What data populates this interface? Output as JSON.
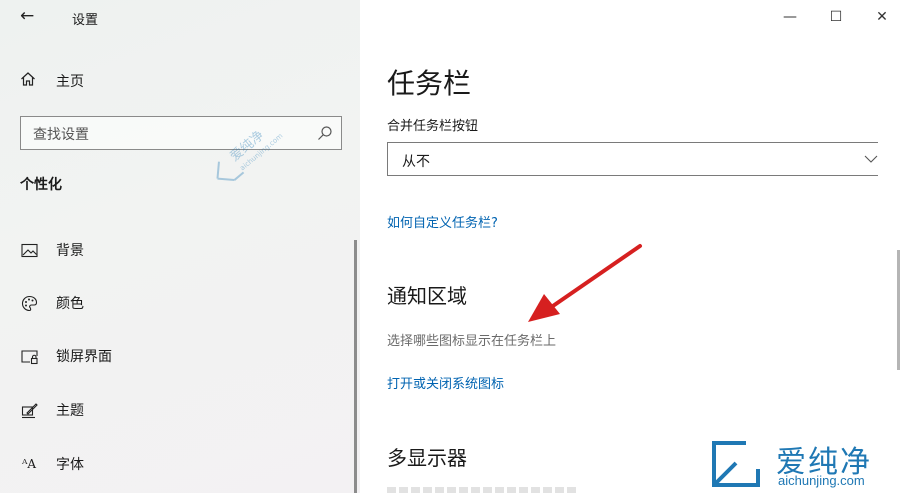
{
  "window": {
    "app_title": "设置",
    "back_glyph": "←",
    "minimize_glyph": "—",
    "maximize_glyph": "☐",
    "close_glyph": "✕"
  },
  "sidebar": {
    "home_label": "主页",
    "search_placeholder": "查找设置",
    "section_header": "个性化",
    "items": [
      {
        "label": "背景",
        "icon": "picture-icon"
      },
      {
        "label": "颜色",
        "icon": "palette-icon"
      },
      {
        "label": "锁屏界面",
        "icon": "lock-screen-icon"
      },
      {
        "label": "主题",
        "icon": "theme-icon"
      },
      {
        "label": "字体",
        "icon": "font-icon",
        "glyph": "ᴬA"
      }
    ]
  },
  "main": {
    "page_title": "任务栏",
    "combine_label": "合并任务栏按钮",
    "combine_value": "从不",
    "customize_link": "如何自定义任务栏?",
    "notification_title": "通知区域",
    "notification_desc": "选择哪些图标显示在任务栏上",
    "system_icons_link": "打开或关闭系统图标",
    "multi_display_title": "多显示器"
  },
  "watermark": {
    "brand_cn": "爱纯净",
    "brand_url": "aichunjing.com",
    "small_cn": "爱纯净",
    "small_url": "aichunjing.com"
  },
  "colors": {
    "accent_link": "#0063b1",
    "annotation_arrow": "#d62020",
    "watermark_blue": "#1f78b4"
  }
}
